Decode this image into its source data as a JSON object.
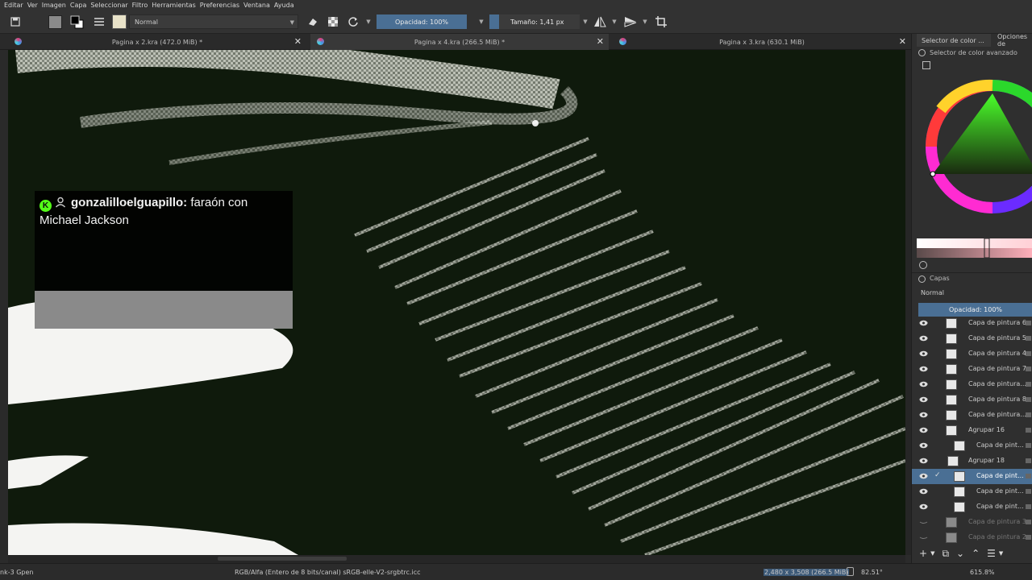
{
  "menu": [
    "Editar",
    "Ver",
    "Imagen",
    "Capa",
    "Seleccionar",
    "Filtro",
    "Herramientas",
    "Preferencias",
    "Ventana",
    "Ayuda"
  ],
  "toolbar": {
    "blend_mode": "Normal",
    "opacity_label": "Opacidad: 100%",
    "size_label": "Tamaño: 1,41 px"
  },
  "tabs": [
    {
      "label": "Pagina x 2.kra (472.0 MiB) *",
      "close": "✕"
    },
    {
      "label": "Pagina x 4.kra (266.5 MiB) *",
      "close": "✕"
    },
    {
      "label": "Pagina x 3.kra (630.1 MiB)",
      "close": "✕"
    }
  ],
  "chat": {
    "badge": "K",
    "username": "gonzalilloelguapillo:",
    "message": " faraón con Michael Jackson"
  },
  "dock": {
    "tab_color_selector": "Selector de color ...",
    "tab_tool_options": "Opciones de",
    "advanced_color_selector": "Selector de color avanzado",
    "layers_title": "Capas",
    "layers_blend_mode": "Normal",
    "layers_opacity": "Opacidad:  100%",
    "layers": [
      {
        "name": "Capa de pintura 6",
        "dim": false
      },
      {
        "name": "Capa de pintura 5",
        "dim": false
      },
      {
        "name": "Capa de pintura 4",
        "dim": false
      },
      {
        "name": "Capa de pintura 7",
        "dim": false
      },
      {
        "name": "Capa de pintura...",
        "dim": false
      },
      {
        "name": "Capa de pintura 8",
        "dim": false
      },
      {
        "name": "Capa de pintura...",
        "dim": false
      },
      {
        "name": "Agrupar 16",
        "dim": false
      },
      {
        "name": "Capa de pint...",
        "dim": false
      },
      {
        "name": "Agrupar 18",
        "dim": false
      },
      {
        "name": "Capa de pint...",
        "dim": false,
        "selected": true
      },
      {
        "name": "Capa de pint...",
        "dim": false
      },
      {
        "name": "Capa de pint...",
        "dim": false
      },
      {
        "name": "Capa de pintura 3",
        "dim": true
      },
      {
        "name": "Capa de pintura 2",
        "dim": true
      }
    ]
  },
  "status": {
    "brush": "nk-3 Gpen",
    "color_space": "RGB/Alfa (Entero de 8 bits/canal)  sRGB-elle-V2-srgbtrc.icc",
    "image_size": "2,480 x 3,508 (266.5 MiB)",
    "rotation": "82.51°",
    "zoom": "615.8%"
  }
}
